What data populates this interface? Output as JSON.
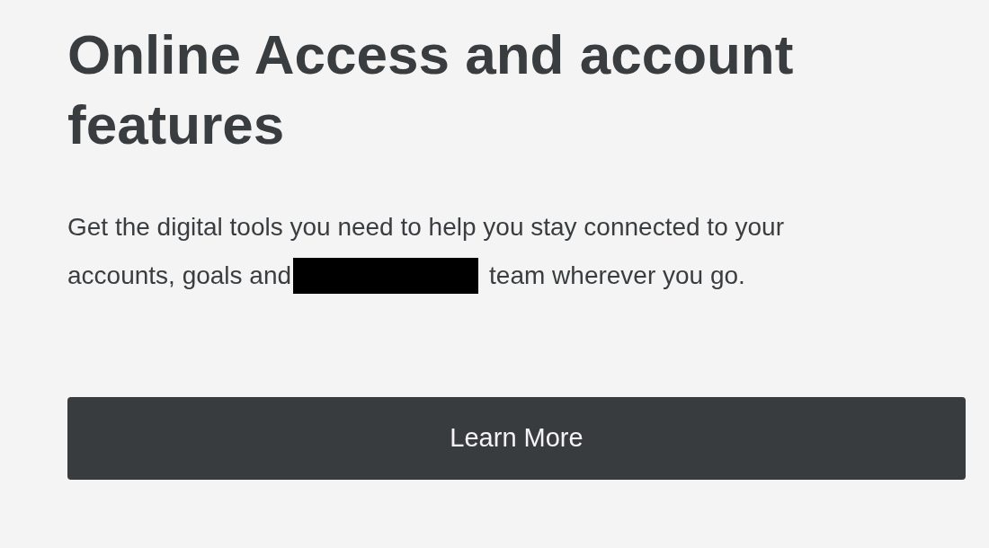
{
  "heading": "Online Access and account features",
  "description": {
    "line_1": "Get the digital tools you need to help you stay connected to your",
    "line_2_before": "accounts, goals and",
    "line_2_after": "team wherever you go."
  },
  "button": {
    "label": "Learn More"
  }
}
